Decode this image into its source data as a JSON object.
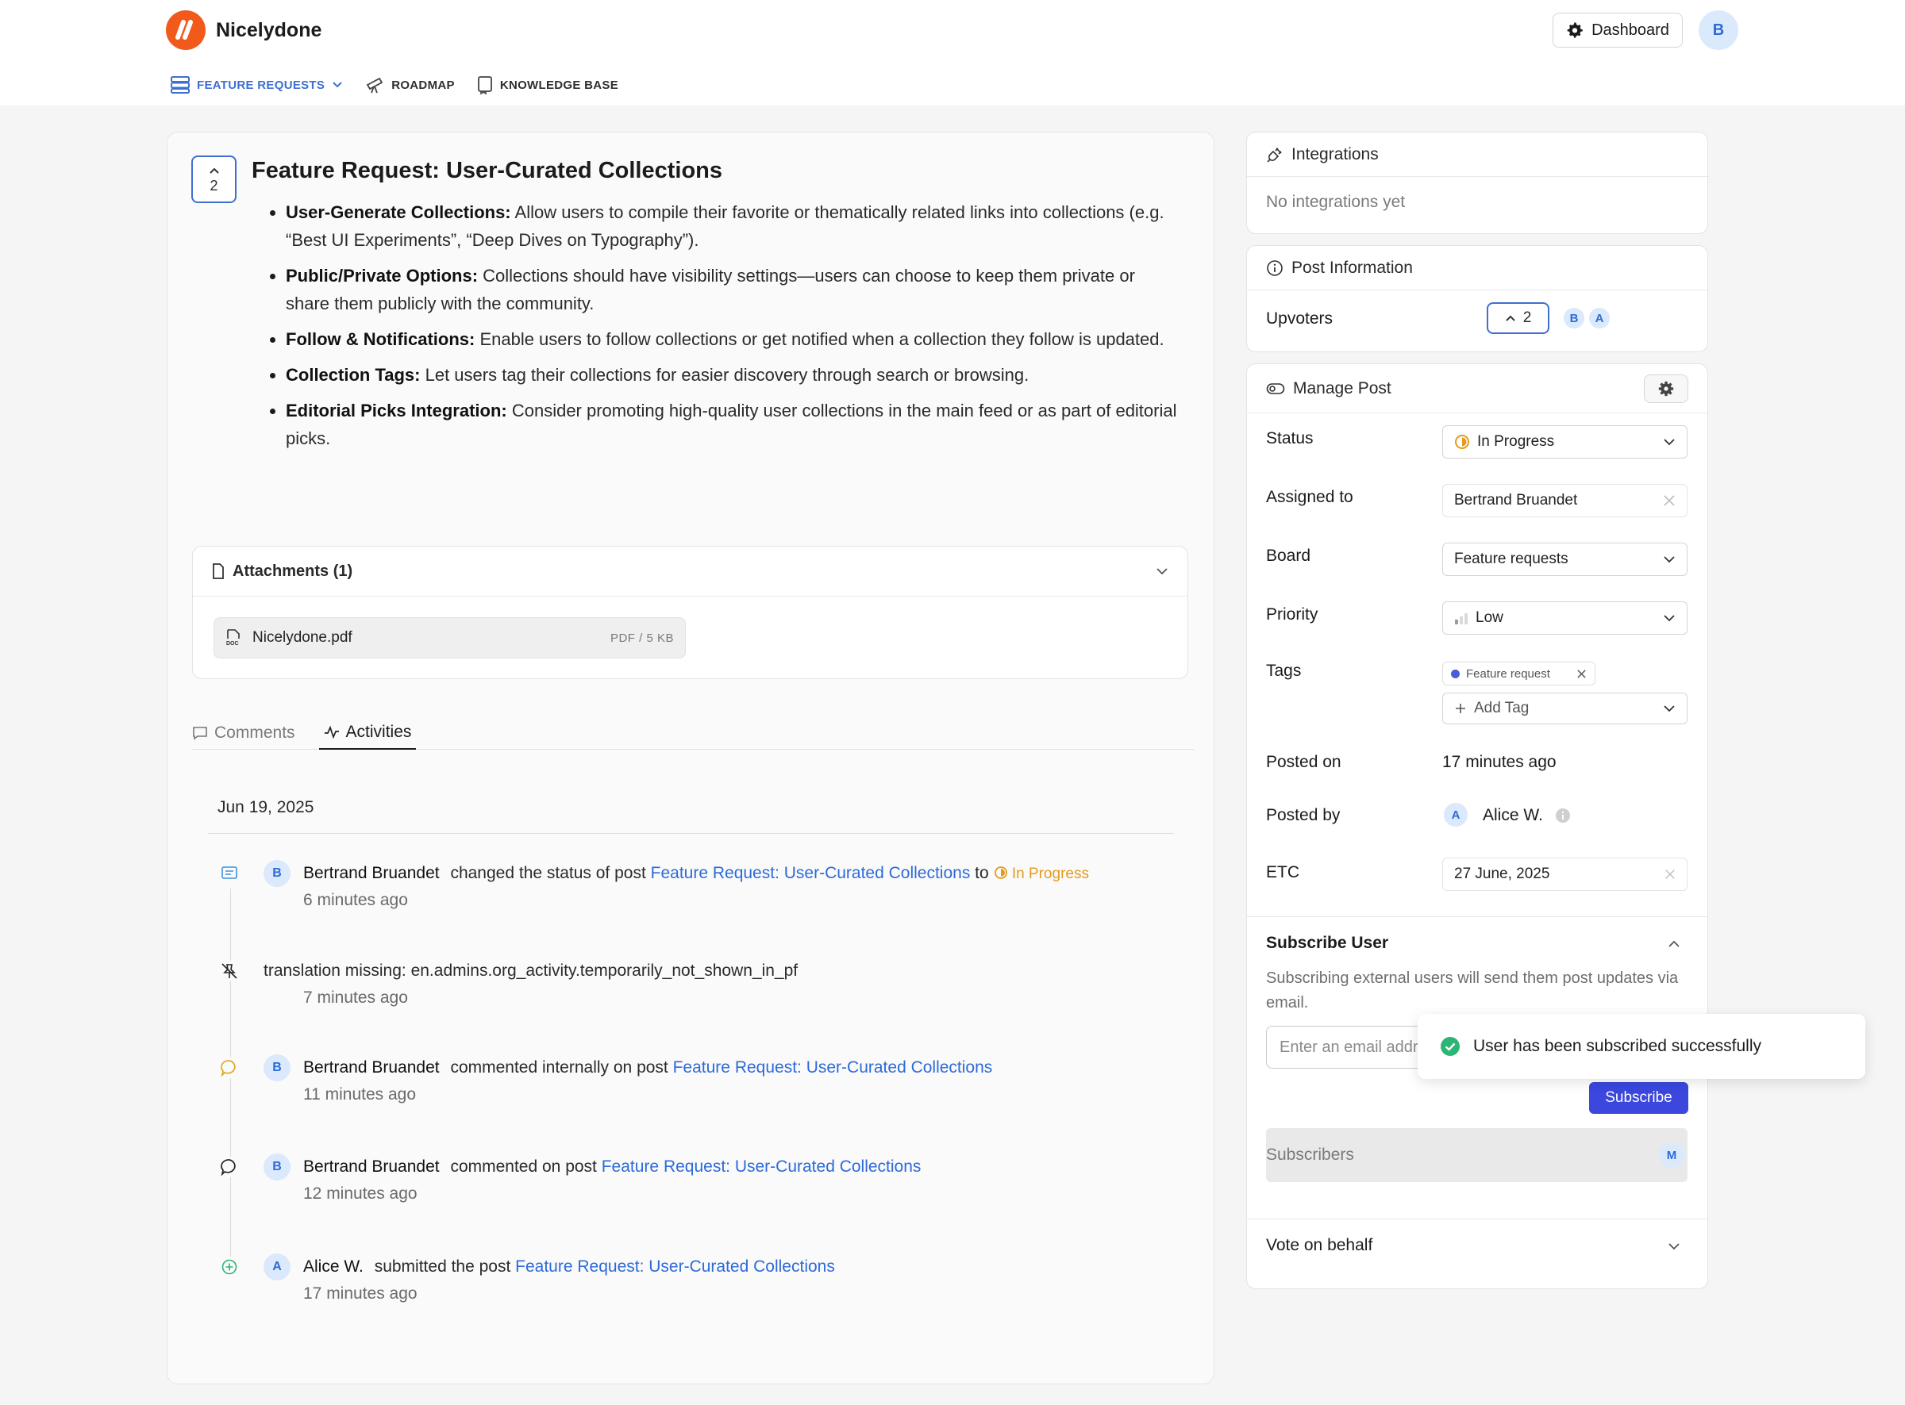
{
  "app": {
    "brand": "Nicelydone",
    "dashboard_label": "Dashboard",
    "user_initial": "B"
  },
  "nav": [
    {
      "label": "FEATURE REQUESTS",
      "icon": "board-icon",
      "active": true
    },
    {
      "label": "ROADMAP",
      "icon": "telescope-icon",
      "active": false
    },
    {
      "label": "KNOWLEDGE BASE",
      "icon": "book-icon",
      "active": false
    }
  ],
  "post": {
    "votes": "2",
    "title": "Feature Request: User-Curated Collections",
    "bullets": [
      {
        "head": "User-Generate Collections:",
        "text": " Allow users to compile their favorite or thematically related links into collections (e.g. “Best UI Experiments”, “Deep Dives on Typography”)."
      },
      {
        "head": "Public/Private Options:",
        "text": " Collections should have visibility settings—users can choose to keep them private or share them publicly with the community."
      },
      {
        "head": "Follow & Notifications:",
        "text": " Enable users to follow collections or get notified when a collection they follow is updated."
      },
      {
        "head": "Collection Tags:",
        "text": " Let users tag their collections for easier discovery through search or browsing."
      },
      {
        "head": "Editorial Picks Integration:",
        "text": " Consider promoting high-quality user collections in the main feed or as part of editorial picks."
      }
    ]
  },
  "attachments": {
    "header": "Attachments (1)",
    "file_name": "Nicelydone.pdf",
    "file_meta": "PDF / 5 KB"
  },
  "tabs": {
    "comments": "Comments",
    "activities": "Activities"
  },
  "activity": {
    "date": "Jun 19, 2025",
    "items": [
      {
        "icon": "status-change-icon",
        "initial": "B",
        "who": "Bertrand Bruandet",
        "action": "changed the status of post",
        "link": "Feature Request: User-Curated Collections",
        "suffix": "to",
        "status": "In Progress",
        "time": "6 minutes ago"
      },
      {
        "icon": "pin-off-icon",
        "initial": "",
        "who": "",
        "action": "translation missing: en.admins.org_activity.temporarily_not_shown_in_pf",
        "link": "",
        "suffix": "",
        "status": "",
        "time": "7 minutes ago"
      },
      {
        "icon": "internal-comment-icon",
        "initial": "B",
        "who": "Bertrand Bruandet",
        "action": "commented internally on post",
        "link": "Feature Request: User-Curated Collections",
        "suffix": "",
        "status": "",
        "time": "11 minutes ago"
      },
      {
        "icon": "comment-icon",
        "initial": "B",
        "who": "Bertrand Bruandet",
        "action": "commented on post",
        "link": "Feature Request: User-Curated Collections",
        "suffix": "",
        "status": "",
        "time": "12 minutes ago"
      },
      {
        "icon": "plus-circle-icon",
        "initial": "A",
        "who": "Alice W.",
        "action": "submitted the post",
        "link": "Feature Request: User-Curated Collections",
        "suffix": "",
        "status": "",
        "time": "17 minutes ago"
      }
    ]
  },
  "integrations": {
    "title": "Integrations",
    "empty": "No integrations yet"
  },
  "post_info": {
    "title": "Post Information",
    "upvoters_label": "Upvoters",
    "upvote_count": "2",
    "upvoters": [
      "B",
      "A"
    ]
  },
  "manage": {
    "title": "Manage Post",
    "status_label": "Status",
    "status_value": "In Progress",
    "assigned_label": "Assigned to",
    "assigned_value": "Bertrand Bruandet",
    "board_label": "Board",
    "board_value": "Feature requests",
    "priority_label": "Priority",
    "priority_value": "Low",
    "tags_label": "Tags",
    "tag": "Feature request",
    "add_tag": "Add Tag",
    "posted_on_label": "Posted on",
    "posted_on_value": "17 minutes ago",
    "posted_by_label": "Posted by",
    "posted_by_initial": "A",
    "posted_by_value": "Alice W.",
    "etc_label": "ETC",
    "etc_value": "27 June, 2025"
  },
  "subscribe": {
    "title": "Subscribe User",
    "description": "Subscribing external users will send them post updates via email.",
    "placeholder": "Enter an email address",
    "button": "Subscribe",
    "subscribers_label": "Subscribers",
    "subscriber_initial": "M"
  },
  "vote_behalf": {
    "title": "Vote on behalf"
  },
  "toast": {
    "message": "User has been subscribed successfully"
  },
  "colors": {
    "accent": "#3f6fd1",
    "link": "#2d6ad9",
    "status": "#e39b1d",
    "primary_button": "#3b47dd",
    "success": "#2bb673",
    "brand": "#f25a1c"
  }
}
